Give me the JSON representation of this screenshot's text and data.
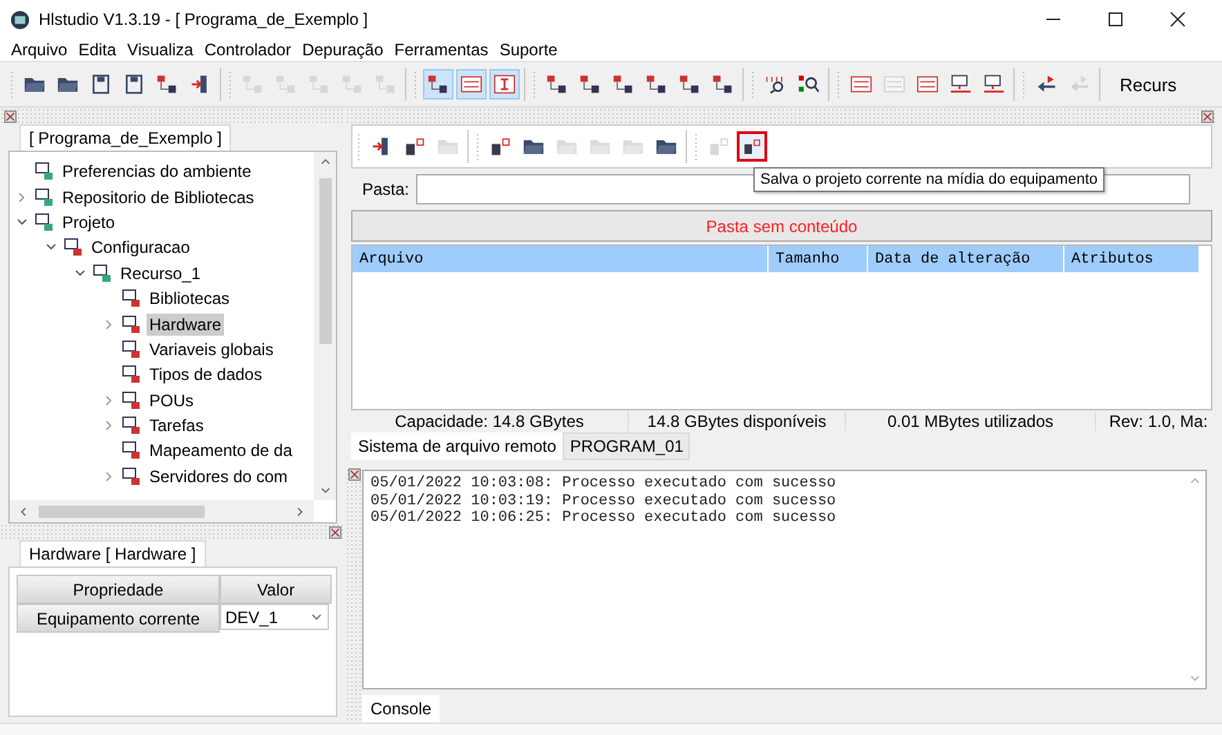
{
  "window": {
    "title": "Hlstudio V1.3.19 - [ Programa_de_Exemplo ]"
  },
  "menu": [
    "Arquivo",
    "Edita",
    "Visualiza",
    "Controlador",
    "Depuração",
    "Ferramentas",
    "Suporte"
  ],
  "toolbar": {
    "groups": [
      [
        {
          "disabled": false
        },
        {
          "disabled": false
        },
        {
          "disabled": false
        },
        {
          "disabled": false
        },
        {
          "disabled": false
        },
        {
          "disabled": false
        }
      ],
      [
        {
          "disabled": true
        },
        {
          "disabled": true
        },
        {
          "disabled": true
        },
        {
          "disabled": true
        },
        {
          "disabled": true
        }
      ],
      [
        {
          "disabled": false,
          "selected": true
        },
        {
          "disabled": false,
          "selected": true
        },
        {
          "disabled": false,
          "selected": true
        }
      ],
      [
        {
          "disabled": false
        },
        {
          "disabled": false
        },
        {
          "disabled": false
        },
        {
          "disabled": false
        },
        {
          "disabled": false
        },
        {
          "disabled": false
        }
      ],
      [
        {
          "disabled": false
        },
        {
          "disabled": false
        }
      ],
      [
        {
          "disabled": false
        },
        {
          "disabled": true
        },
        {
          "disabled": false
        },
        {
          "disabled": false
        },
        {
          "disabled": false
        }
      ],
      [
        {
          "disabled": false
        },
        {
          "disabled": true
        }
      ]
    ],
    "overflow_label": "Recurs"
  },
  "project_panel": {
    "tab": "[ Programa_de_Exemplo ]",
    "tree": [
      {
        "label": "Preferencias do ambiente",
        "selected": false
      },
      {
        "label": "Repositorio de Bibliotecas",
        "selected": false,
        "expanded": false
      },
      {
        "label": "Projeto",
        "selected": false,
        "expanded": true,
        "children": [
          {
            "label": "Configuracao",
            "selected": false,
            "expanded": true,
            "children": [
              {
                "label": "Recurso_1",
                "selected": false,
                "expanded": true,
                "children": [
                  {
                    "label": "Bibliotecas",
                    "selected": false
                  },
                  {
                    "label": "Hardware",
                    "selected": true,
                    "expanded": false
                  },
                  {
                    "label": "Variaveis globais",
                    "selected": false
                  },
                  {
                    "label": "Tipos de dados",
                    "selected": false
                  },
                  {
                    "label": "POUs",
                    "selected": false,
                    "expanded": false
                  },
                  {
                    "label": "Tarefas",
                    "selected": false,
                    "expanded": false
                  },
                  {
                    "label": "Mapeamento de da",
                    "selected": false
                  },
                  {
                    "label": "Servidores do com",
                    "selected": false,
                    "expanded": false
                  }
                ]
              }
            ]
          }
        ]
      }
    ]
  },
  "properties_panel": {
    "tab": "Hardware [ Hardware ]",
    "columns": [
      "Propriedade",
      "Valor"
    ],
    "rows": [
      {
        "property": "Equipamento corrente",
        "value": "DEV_1"
      }
    ]
  },
  "file_panel": {
    "toolbar": [
      [
        {
          "disabled": false,
          "highlighted": false
        },
        {
          "disabled": false,
          "highlighted": false
        },
        {
          "disabled": true,
          "highlighted": false
        }
      ],
      [
        {
          "disabled": false,
          "highlighted": false
        },
        {
          "disabled": false,
          "highlighted": false
        },
        {
          "disabled": true,
          "highlighted": false
        },
        {
          "disabled": true,
          "highlighted": false
        },
        {
          "disabled": true,
          "highlighted": false
        },
        {
          "disabled": false,
          "highlighted": false
        }
      ],
      [
        {
          "disabled": true,
          "highlighted": false
        },
        {
          "disabled": false,
          "highlighted": true
        }
      ]
    ],
    "tooltip": "Salva o projeto corrente na mídia do equipamento",
    "folder_label": "Pasta:",
    "message": "Pasta sem conteúdo",
    "columns": [
      "Arquivo",
      "Tamanho",
      "Data de alteração",
      "Atributos"
    ],
    "status": [
      "Capacidade: 14.8 GBytes",
      "14.8 GBytes disponíveis",
      "0.01 MBytes utilizados",
      "Rev: 1.0, Ma:"
    ],
    "tabs": [
      {
        "label": "Sistema de arquivo remoto",
        "selected": true
      },
      {
        "label": "PROGRAM_01",
        "selected": false
      }
    ]
  },
  "console": {
    "lines": [
      "05/01/2022 10:03:08: Processo executado com sucesso",
      "05/01/2022 10:03:19: Processo executado com sucesso",
      "05/01/2022 10:06:25: Processo executado com sucesso"
    ],
    "tab": "Console"
  }
}
